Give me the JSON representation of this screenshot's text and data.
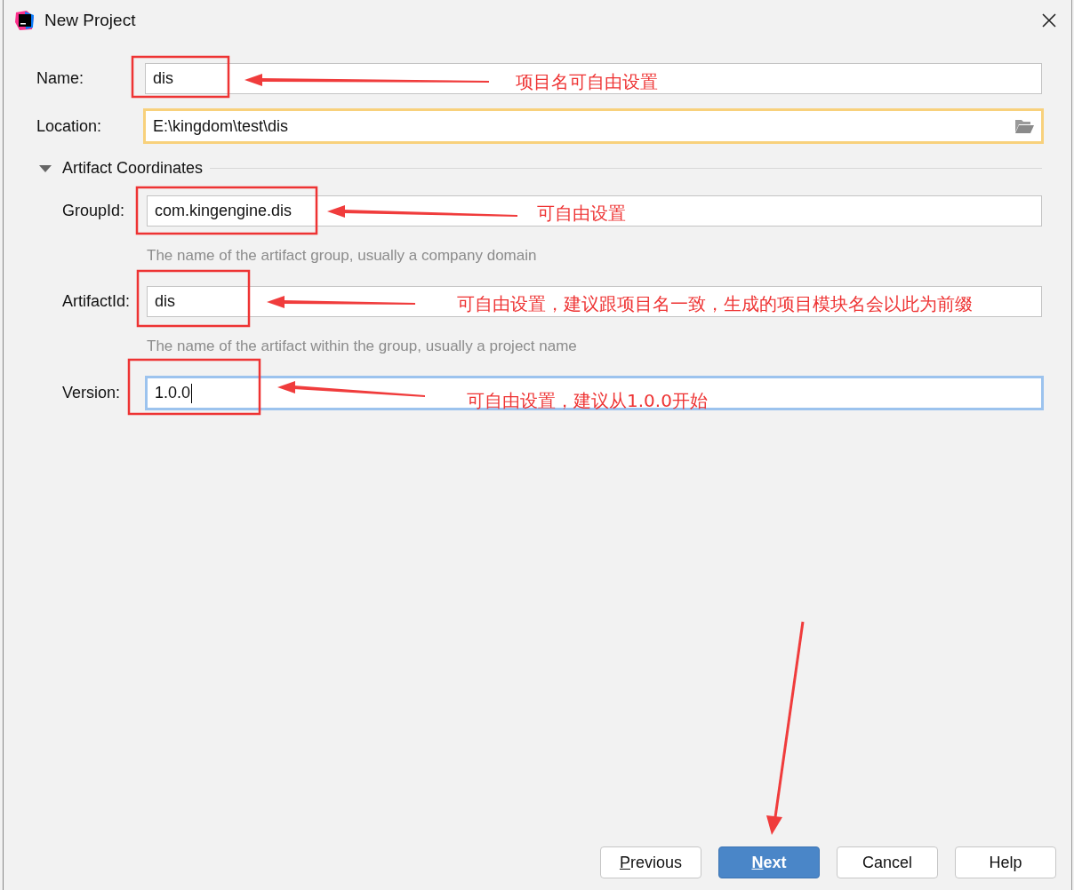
{
  "window": {
    "title": "New Project"
  },
  "fields": [
    {
      "label": "Name:",
      "value": "dis",
      "warning": false,
      "focused": false,
      "annotation": "项目名可自由设置"
    },
    {
      "label": "Location:",
      "value": "E:\\kingdom\\test\\dis",
      "warning": true,
      "focused": false,
      "browse": true
    }
  ],
  "section": {
    "title": "Artifact Coordinates",
    "expanded": true,
    "fields": [
      {
        "label": "GroupId:",
        "value": "com.kingengine.dis",
        "warning": false,
        "focused": false,
        "hint": "The name of the artifact group, usually a company domain",
        "annotation": "可自由设置"
      },
      {
        "label": "ArtifactId:",
        "value": "dis",
        "warning": false,
        "focused": false,
        "hint": "The name of the artifact within the group, usually a project name",
        "annotation": "可自由设置，建议跟项目名一致，生成的项目模块名会以此为前缀"
      },
      {
        "label": "Version:",
        "value": "1.0.0",
        "warning": false,
        "focused": true,
        "annotation": "可自由设置，建议从1.0.0开始"
      }
    ]
  },
  "buttons": [
    {
      "mnemonic": "P",
      "label_rest": "revious",
      "default": false
    },
    {
      "mnemonic": "N",
      "label_rest": "ext",
      "default": true
    },
    {
      "label": "Cancel",
      "default": false
    },
    {
      "label": "Help",
      "default": false
    }
  ]
}
